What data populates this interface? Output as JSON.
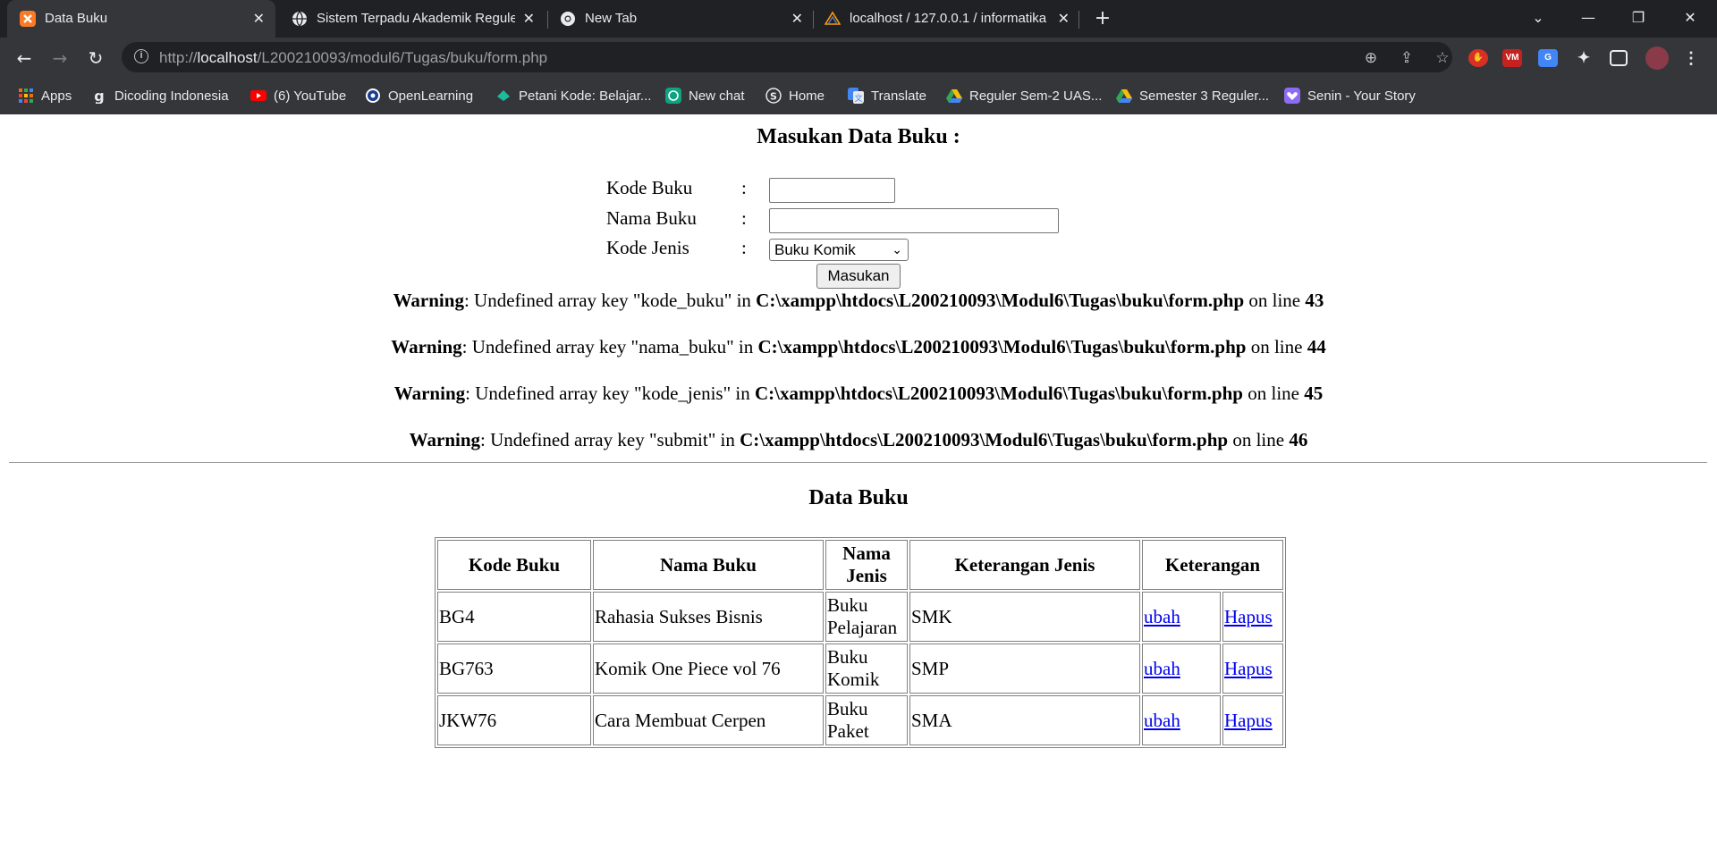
{
  "browser": {
    "tabs": [
      {
        "title": "Data Buku",
        "icon": "xampp-icon"
      },
      {
        "title": "Sistem Terpadu Akademik Reguler",
        "icon": "globe-icon"
      },
      {
        "title": "New Tab",
        "icon": "chrome-icon"
      },
      {
        "title": "localhost / 127.0.0.1 / informatika",
        "icon": "phpmyadmin-icon"
      }
    ],
    "close_glyph": "✕",
    "new_tab_glyph": "+",
    "url_prefix": "http://",
    "url_host": "localhost",
    "url_path": "/L200210093/modul6/Tugas/buku/form.php",
    "bookmarks": [
      {
        "label": "Apps",
        "icon": "apps-grid-icon",
        "color": "#e8710a"
      },
      {
        "label": "Dicoding Indonesia",
        "icon": "dicoding-icon",
        "color": "#e8eaed"
      },
      {
        "label": "(6) YouTube",
        "icon": "youtube-icon",
        "color": "#ff0000"
      },
      {
        "label": "OpenLearning",
        "icon": "openlearning-icon",
        "color": "#1a3d8f"
      },
      {
        "label": "Petani Kode: Belajar...",
        "icon": "petanikode-icon",
        "color": "#1abc9c"
      },
      {
        "label": "New chat",
        "icon": "openai-icon",
        "color": "#10a37f"
      },
      {
        "label": "Home",
        "icon": "home-s-icon",
        "color": "#e8eaed"
      },
      {
        "label": "Translate",
        "icon": "google-translate-icon",
        "color": "#4285f4"
      },
      {
        "label": "Reguler Sem-2 UAS...",
        "icon": "google-drive-icon",
        "color": "#fbbc04"
      },
      {
        "label": "Semester 3 Reguler...",
        "icon": "google-drive-icon",
        "color": "#fbbc04"
      },
      {
        "label": "Senin - Your Story",
        "icon": "heart-icon",
        "color": "#8e6bf5"
      }
    ]
  },
  "form": {
    "title": "Masukan Data Buku :",
    "colon": ":",
    "kode_buku_label": "Kode Buku",
    "nama_buku_label": "Nama Buku",
    "kode_jenis_label": "Kode Jenis",
    "kode_buku_value": "",
    "nama_buku_value": "",
    "kode_jenis_selected": "Buku Komik",
    "submit_label": "Masukan"
  },
  "warnings": [
    {
      "label": "Warning",
      "message": ": Undefined array key \"kode_buku\" in ",
      "path": "C:\\xampp\\htdocs\\L200210093\\Modul6\\Tugas\\buku\\form.php",
      "on_line": " on line ",
      "line": "43"
    },
    {
      "label": "Warning",
      "message": ": Undefined array key \"nama_buku\" in ",
      "path": "C:\\xampp\\htdocs\\L200210093\\Modul6\\Tugas\\buku\\form.php",
      "on_line": " on line ",
      "line": "44"
    },
    {
      "label": "Warning",
      "message": ": Undefined array key \"kode_jenis\" in ",
      "path": "C:\\xampp\\htdocs\\L200210093\\Modul6\\Tugas\\buku\\form.php",
      "on_line": " on line ",
      "line": "45"
    },
    {
      "label": "Warning",
      "message": ": Undefined array key \"submit\" in ",
      "path": "C:\\xampp\\htdocs\\L200210093\\Modul6\\Tugas\\buku\\form.php",
      "on_line": " on line ",
      "line": "46"
    }
  ],
  "data_table": {
    "title": "Data Buku",
    "headers": [
      "Kode Buku",
      "Nama Buku",
      "Nama Jenis",
      "Keterangan Jenis",
      "Keterangan"
    ],
    "rows": [
      {
        "kode": "BG4",
        "nama": "Rahasia Sukses Bisnis",
        "jenis": "Buku Pelajaran",
        "ket_jenis": "SMK",
        "ubah": "ubah",
        "hapus": "Hapus"
      },
      {
        "kode": "BG763",
        "nama": "Komik One Piece vol 76",
        "jenis": "Buku Komik",
        "ket_jenis": "SMP",
        "ubah": "ubah",
        "hapus": "Hapus"
      },
      {
        "kode": "JKW76",
        "nama": "Cara Membuat Cerpen",
        "jenis": "Buku Paket",
        "ket_jenis": "SMA",
        "ubah": "ubah",
        "hapus": "Hapus"
      }
    ]
  }
}
